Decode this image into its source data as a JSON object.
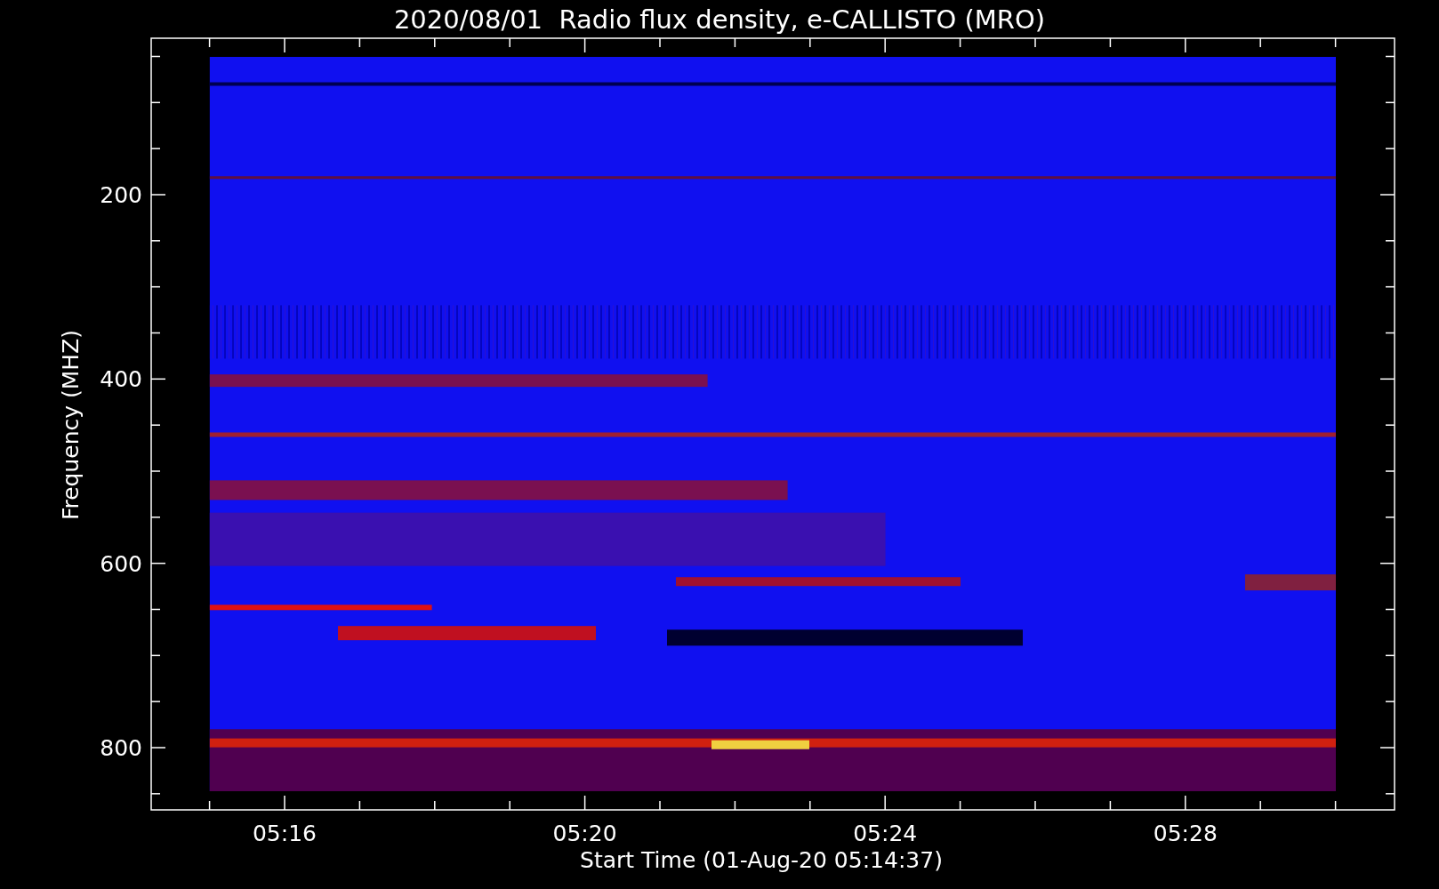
{
  "title": "2020/08/01  Radio flux density, e-CALLISTO (MRO)",
  "plot": {
    "ylabel": "Frequency (MHZ)",
    "xlabel": "Start Time (01-Aug-20 05:14:37)",
    "yticks": [
      "200",
      "400",
      "600",
      "800"
    ],
    "xticks": [
      "05:16",
      "05:20",
      "05:24",
      "05:28"
    ]
  }
}
